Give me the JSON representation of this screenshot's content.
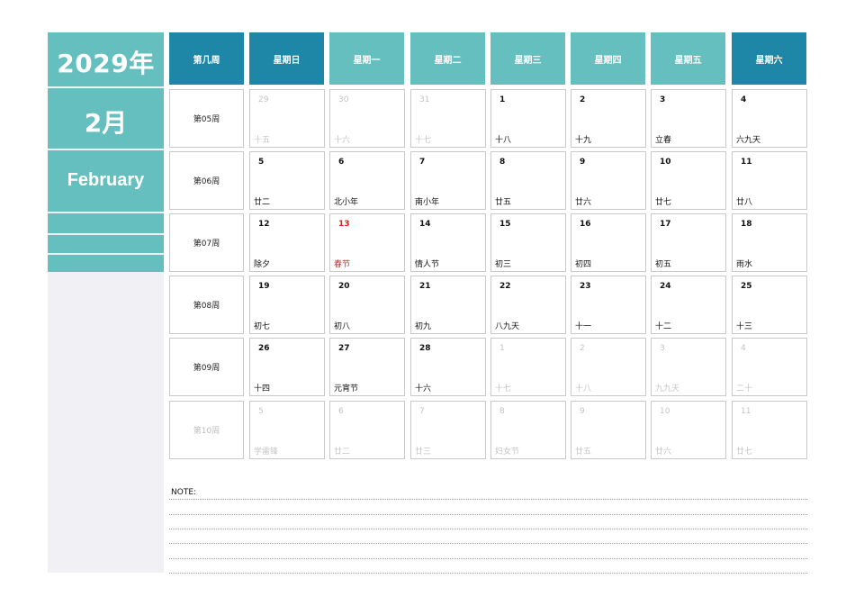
{
  "year_label": "2029年",
  "month_label": "2月",
  "month_en": "February",
  "header": [
    "第几周",
    "星期日",
    "星期一",
    "星期二",
    "星期三",
    "星期四",
    "星期五",
    "星期六"
  ],
  "colors": {
    "dark_header": "#1e86a6",
    "light_header": "#65bfbf",
    "festival": "#e8190f",
    "sidebar_bg": "#f0f0f5"
  },
  "weeks": [
    {
      "label": "第05周",
      "other": false,
      "days": [
        {
          "num": "29",
          "lunar": "十五",
          "other": true
        },
        {
          "num": "30",
          "lunar": "十六",
          "other": true
        },
        {
          "num": "31",
          "lunar": "十七",
          "other": true
        },
        {
          "num": "1",
          "lunar": "十八"
        },
        {
          "num": "2",
          "lunar": "十九"
        },
        {
          "num": "3",
          "lunar": "立春"
        },
        {
          "num": "4",
          "lunar": "六九天"
        }
      ]
    },
    {
      "label": "第06周",
      "other": false,
      "days": [
        {
          "num": "5",
          "lunar": "廿二"
        },
        {
          "num": "6",
          "lunar": "北小年"
        },
        {
          "num": "7",
          "lunar": "南小年"
        },
        {
          "num": "8",
          "lunar": "廿五"
        },
        {
          "num": "9",
          "lunar": "廿六"
        },
        {
          "num": "10",
          "lunar": "廿七"
        },
        {
          "num": "11",
          "lunar": "廿八"
        }
      ]
    },
    {
      "label": "第07周",
      "other": false,
      "days": [
        {
          "num": "12",
          "lunar": "除夕"
        },
        {
          "num": "13",
          "lunar": "春节",
          "festival": true
        },
        {
          "num": "14",
          "lunar": "情人节"
        },
        {
          "num": "15",
          "lunar": "初三"
        },
        {
          "num": "16",
          "lunar": "初四"
        },
        {
          "num": "17",
          "lunar": "初五"
        },
        {
          "num": "18",
          "lunar": "雨水"
        }
      ]
    },
    {
      "label": "第08周",
      "other": false,
      "days": [
        {
          "num": "19",
          "lunar": "初七"
        },
        {
          "num": "20",
          "lunar": "初八"
        },
        {
          "num": "21",
          "lunar": "初九"
        },
        {
          "num": "22",
          "lunar": "八九天"
        },
        {
          "num": "23",
          "lunar": "十一"
        },
        {
          "num": "24",
          "lunar": "十二"
        },
        {
          "num": "25",
          "lunar": "十三"
        }
      ]
    },
    {
      "label": "第09周",
      "other": false,
      "days": [
        {
          "num": "26",
          "lunar": "十四"
        },
        {
          "num": "27",
          "lunar": "元宵节"
        },
        {
          "num": "28",
          "lunar": "十六"
        },
        {
          "num": "1",
          "lunar": "十七",
          "other": true
        },
        {
          "num": "2",
          "lunar": "十八",
          "other": true
        },
        {
          "num": "3",
          "lunar": "九九天",
          "other": true
        },
        {
          "num": "4",
          "lunar": "二十",
          "other": true
        }
      ]
    },
    {
      "label": "第10周",
      "other": true,
      "days": [
        {
          "num": "5",
          "lunar": "学雷锋",
          "other": true
        },
        {
          "num": "6",
          "lunar": "廿二",
          "other": true
        },
        {
          "num": "7",
          "lunar": "廿三",
          "other": true
        },
        {
          "num": "8",
          "lunar": "妇女节",
          "other": true
        },
        {
          "num": "9",
          "lunar": "廿五",
          "other": true
        },
        {
          "num": "10",
          "lunar": "廿六",
          "other": true
        },
        {
          "num": "11",
          "lunar": "廿七",
          "other": true
        }
      ]
    }
  ],
  "note_label": "NOTE:"
}
